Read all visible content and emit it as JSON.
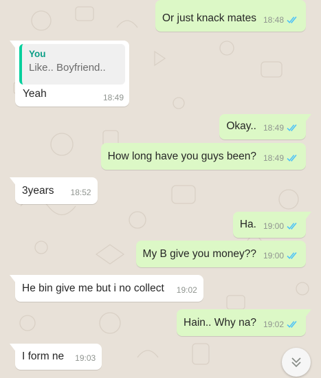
{
  "colors": {
    "outgoing_bubble": "#dcf8c6",
    "incoming_bubble": "#ffffff",
    "read_ticks": "#4fc3f7",
    "quote_accent": "#06cf9c",
    "wallpaper": "#e8e1d8"
  },
  "messages": [
    {
      "direction": "out",
      "text": "Or just knack mates",
      "time": "18:48",
      "status": "read"
    },
    {
      "direction": "in",
      "quote": {
        "author": "You",
        "text": "Like.. Boyfriend.."
      },
      "text": "Yeah",
      "time": "18:49"
    },
    {
      "direction": "out",
      "text": "Okay..",
      "time": "18:49",
      "status": "read"
    },
    {
      "direction": "out",
      "text": "How long have you guys been?",
      "time": "18:49",
      "status": "read"
    },
    {
      "direction": "in",
      "text": "3years",
      "time": "18:52"
    },
    {
      "direction": "out",
      "text": "Ha.",
      "time": "19:00",
      "status": "read"
    },
    {
      "direction": "out",
      "text": "My B give you money??",
      "time": "19:00",
      "status": "read"
    },
    {
      "direction": "in",
      "text": "He bin give me but i no collect",
      "time": "19:02"
    },
    {
      "direction": "out",
      "text": "Hain.. Why na?",
      "time": "19:02",
      "status": "read"
    },
    {
      "direction": "in",
      "text": "I form ne",
      "time": "19:03"
    }
  ],
  "scroll_button": {
    "icon": "double-chevron-down-icon"
  }
}
